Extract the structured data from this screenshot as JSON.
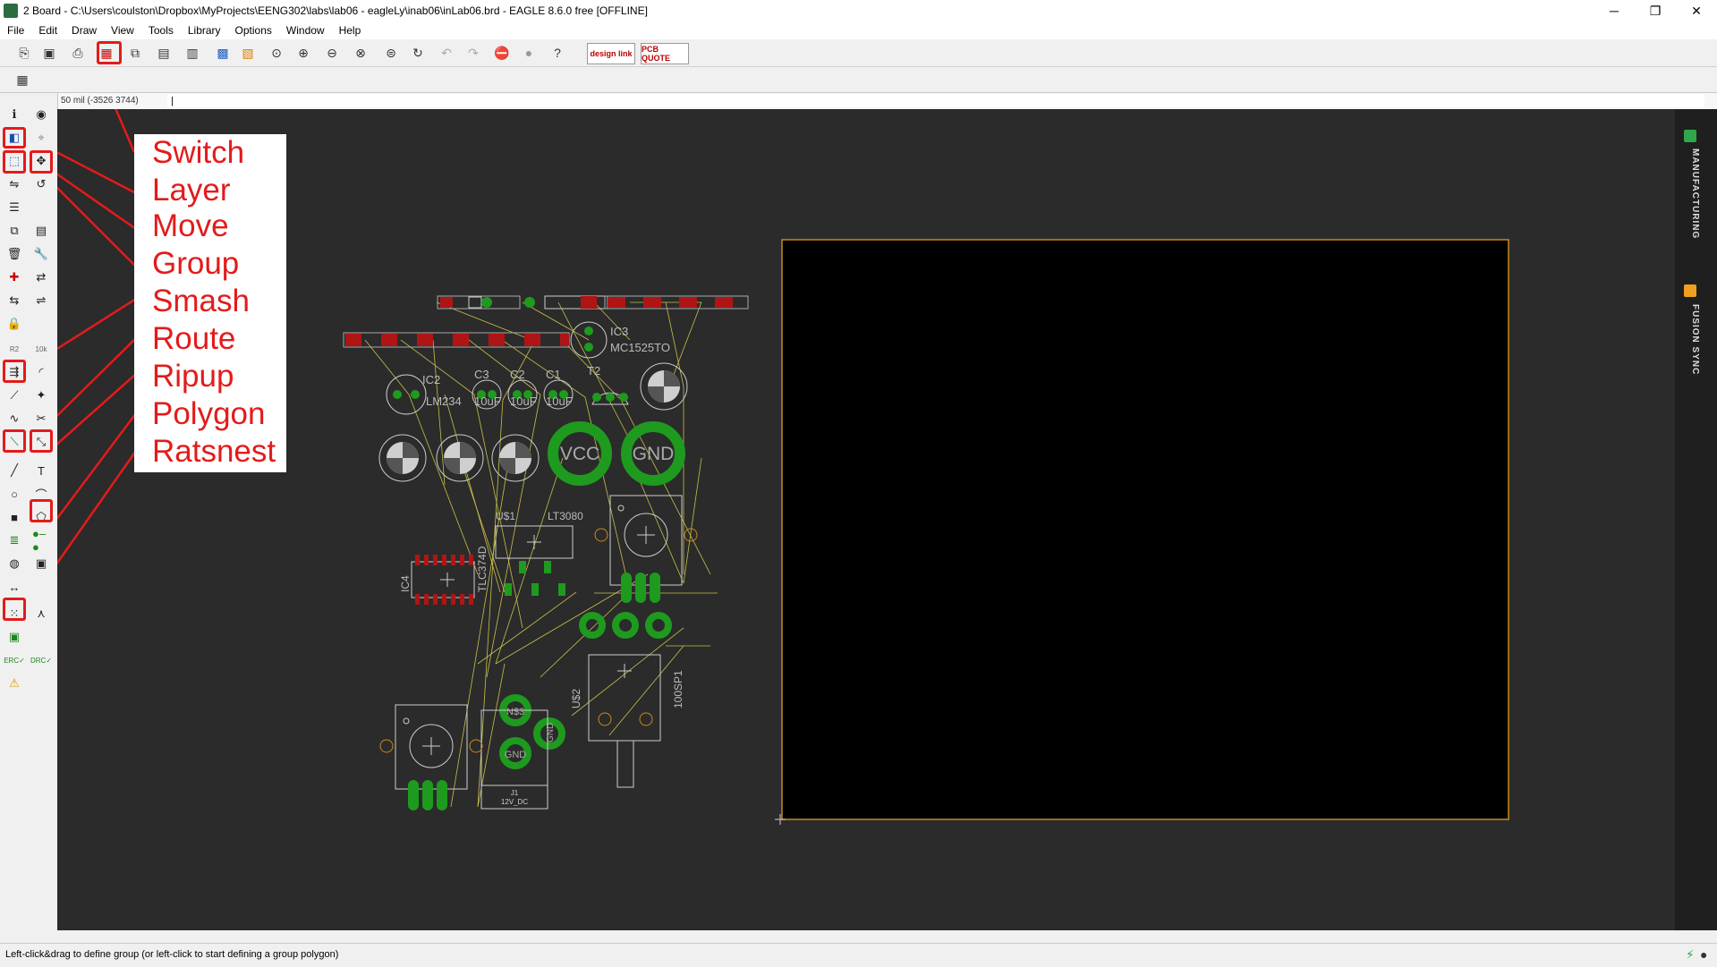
{
  "window": {
    "title": "2 Board - C:\\Users\\coulston\\Dropbox\\MyProjects\\EENG302\\labs\\lab06 - eagleLy\\inab06\\inLab06.brd - EAGLE 8.6.0 free [OFFLINE]",
    "minimize": "─",
    "restore": "❐",
    "close": "✕"
  },
  "menu": [
    "File",
    "Edit",
    "Draw",
    "View",
    "Tools",
    "Library",
    "Options",
    "Window",
    "Help"
  ],
  "toolbar": {
    "design_link": "design link",
    "pcb_quote": "PCB QUOTE"
  },
  "command": {
    "coordinate": "50 mil (-3526 3744)",
    "value": "|"
  },
  "annotations": [
    "Switch",
    "Layer",
    "Move",
    "Group",
    "Smash",
    "Route",
    "Ripup",
    "Polygon",
    "Ratsnest"
  ],
  "right_panel": {
    "manufacturing": "MANUFACTURING",
    "fusion_sync": "FUSION SYNC"
  },
  "board_labels": {
    "ic3": "IC3",
    "mc1525": "MC1525TO",
    "ic2": "IC2",
    "lm234": "LM234",
    "c3": "C3",
    "c2": "C2",
    "c1": "C1",
    "t2": "T2",
    "cap": "10uF",
    "vcc": "VCC",
    "gnd": "GND",
    "us1": "U$1",
    "lt3080": "LT3080",
    "ic4": "IC4",
    "tlc374d": "TLC374D",
    "us2": "U$2",
    "sp1": "100SP1",
    "ns3": "N$3",
    "gnd2": "GND",
    "gnd3": "GND",
    "j1": "J1",
    "j1v": "12V_DC"
  },
  "status": {
    "message": "Left-click&drag to define group (or left-click to start defining a group polygon)"
  },
  "colors": {
    "canvas": "#2b2b2b",
    "pad_green": "#1e9a1e",
    "board_outline": "#c88a20",
    "annotation_red": "#e31b1b",
    "smd_red": "#b01515"
  }
}
